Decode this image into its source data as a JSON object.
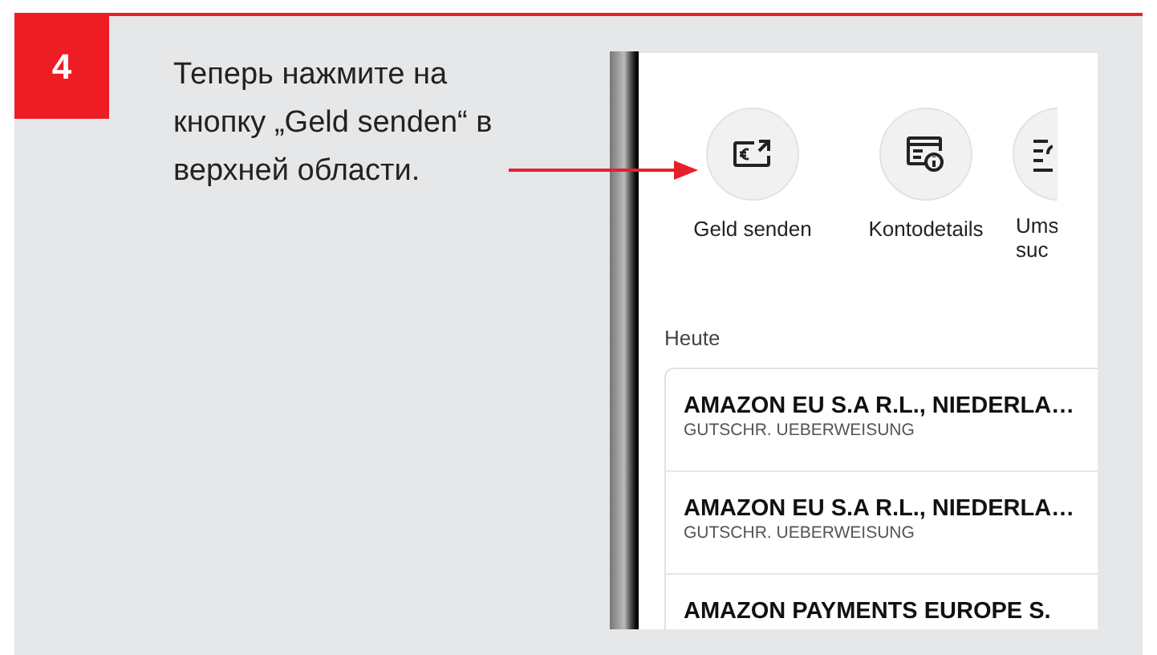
{
  "step": {
    "number": "4",
    "instruction": "Теперь нажмите на кнопку „Geld senden“ в верхней области."
  },
  "phone": {
    "quick_actions": [
      {
        "kind": "send",
        "lines": [
          "Geld senden"
        ]
      },
      {
        "kind": "details",
        "lines": [
          "Kontodetails"
        ]
      },
      {
        "kind": "search",
        "lines": [
          "Ums",
          "suc"
        ]
      }
    ],
    "section_title": "Heute",
    "transactions": [
      {
        "title": "AMAZON EU S.A R.L., NIEDERLA…",
        "subtitle": "GUTSCHR. UEBERWEISUNG"
      },
      {
        "title": "AMAZON EU S.A R.L., NIEDERLA…",
        "subtitle": "GUTSCHR. UEBERWEISUNG"
      },
      {
        "title": "AMAZON PAYMENTS EUROPE S."
      }
    ]
  }
}
